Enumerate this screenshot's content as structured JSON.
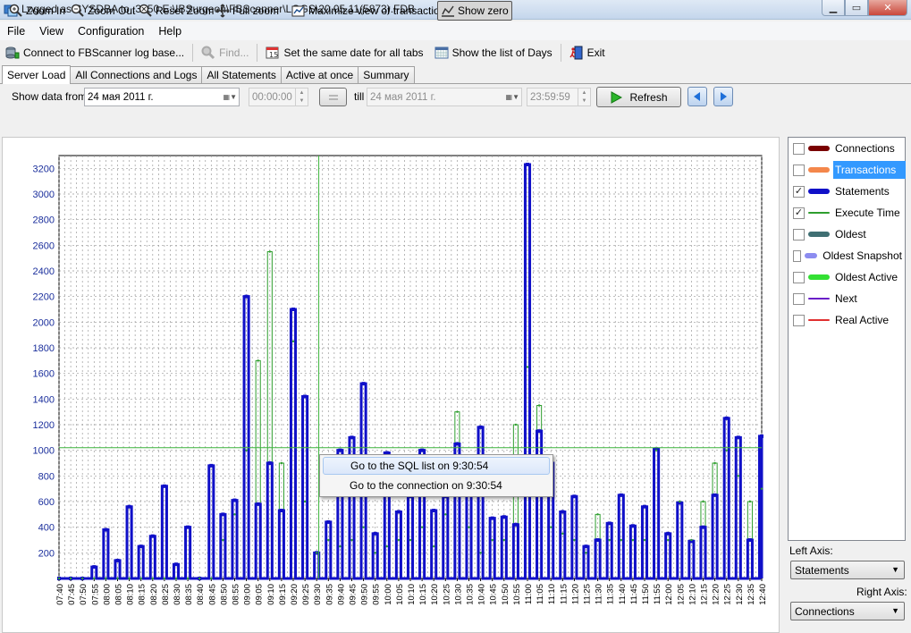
{
  "window": {
    "title": "Logged as SYSDBA to :3050 E:\\IBSurgeon\\FBScanner\\LOGS\\20.05.11(5873).FDB"
  },
  "menu": [
    "File",
    "View",
    "Configuration",
    "Help"
  ],
  "toolbar": {
    "connect": "Connect to FBScanner log base...",
    "find": "Find...",
    "same_date": "Set the same date for all tabs",
    "list_days": "Show the list of Days",
    "exit": "Exit"
  },
  "tabs": [
    "Server Load",
    "All Connections and Logs",
    "All Statements",
    "Active at once",
    "Summary"
  ],
  "daterow": {
    "show_from_label": "Show data from",
    "from_date": "24    мая    2011 г.",
    "from_time": "00:00:00",
    "till_label": "till",
    "till_date": "24    мая    2011 г.",
    "till_time": "23:59:59",
    "refresh": "Refresh"
  },
  "zoom": {
    "zoom_in": "Zoom In",
    "zoom_out": "Zoom Out",
    "reset": "Reset Zoom",
    "full": "Full zoom",
    "maximize": "Maximize view of transaction",
    "show_zero": "Show zero"
  },
  "legend": [
    {
      "label": "Connections",
      "checked": false,
      "color": "#7a0000",
      "thick": true
    },
    {
      "label": "Transactions",
      "checked": false,
      "color": "#f4874b",
      "thick": true,
      "selected": true
    },
    {
      "label": "Statements",
      "checked": true,
      "color": "#1010c8",
      "thick": true
    },
    {
      "label": "Execute Time",
      "checked": true,
      "color": "#2e9e2e",
      "thick": false
    },
    {
      "label": "Oldest",
      "checked": false,
      "color": "#3f6f73",
      "thick": true
    },
    {
      "label": "Oldest Snapshot",
      "checked": false,
      "color": "#8c8cf0",
      "thick": true
    },
    {
      "label": "Oldest Active",
      "checked": false,
      "color": "#33e033",
      "thick": true
    },
    {
      "label": "Next",
      "checked": false,
      "color": "#6a1ec8",
      "thick": false
    },
    {
      "label": "Real Active",
      "checked": false,
      "color": "#e03030",
      "thick": false
    }
  ],
  "axes_select": {
    "left_label": "Left Axis:",
    "left_value": "Statements",
    "right_label": "Right Axis:",
    "right_value": "Connections"
  },
  "context_menu": {
    "item1": "Go to the SQL list on 9:30:54",
    "item2": "Go to the connection on 9:30:54"
  },
  "chart_data": {
    "type": "line",
    "ylim": [
      0,
      3300
    ],
    "yticks": [
      200,
      400,
      600,
      800,
      1000,
      1200,
      1400,
      1600,
      1800,
      2000,
      2200,
      2400,
      2600,
      2800,
      3000,
      3200
    ],
    "x": [
      "07:40",
      "07:45",
      "07:50",
      "07:55",
      "08:00",
      "08:05",
      "08:10",
      "08:15",
      "08:20",
      "08:25",
      "08:30",
      "08:35",
      "08:40",
      "08:45",
      "08:50",
      "08:55",
      "09:00",
      "09:05",
      "09:10",
      "09:15",
      "09:20",
      "09:25",
      "09:30",
      "09:35",
      "09:40",
      "09:45",
      "09:50",
      "09:55",
      "10:00",
      "10:05",
      "10:10",
      "10:15",
      "10:20",
      "10:25",
      "10:30",
      "10:35",
      "10:40",
      "10:45",
      "10:50",
      "10:55",
      "11:00",
      "11:05",
      "11:10",
      "11:15",
      "11:20",
      "11:25",
      "11:30",
      "11:35",
      "11:40",
      "11:45",
      "11:50",
      "11:55",
      "12:00",
      "12:05",
      "12:10",
      "12:15",
      "12:20",
      "12:25",
      "12:30",
      "12:35",
      "12:40"
    ],
    "series": [
      {
        "name": "Statements",
        "color": "#1010c8",
        "values": [
          0,
          0,
          0,
          90,
          380,
          140,
          560,
          250,
          330,
          720,
          110,
          400,
          0,
          880,
          500,
          610,
          2200,
          580,
          900,
          530,
          2100,
          1420,
          200,
          440,
          1000,
          1100,
          1520,
          350,
          980,
          520,
          640,
          1000,
          530,
          640,
          1050,
          700,
          1180,
          470,
          480,
          420,
          3230,
          1150,
          900,
          520,
          640,
          250,
          300,
          430,
          650,
          410,
          560,
          1010,
          350,
          590,
          290,
          400,
          650,
          1250,
          1100,
          300,
          1110
        ]
      },
      {
        "name": "Execute Time",
        "color": "#2e9e2e",
        "values": [
          0,
          0,
          0,
          0,
          0,
          0,
          0,
          0,
          0,
          0,
          0,
          0,
          0,
          0,
          300,
          500,
          1000,
          1700,
          2550,
          900,
          1850,
          600,
          200,
          300,
          250,
          300,
          400,
          200,
          250,
          300,
          300,
          400,
          250,
          500,
          1300,
          400,
          200,
          300,
          300,
          1200,
          1650,
          1350,
          400,
          350,
          300,
          200,
          500,
          300,
          300,
          300,
          300,
          1000,
          300,
          600,
          300,
          600,
          900,
          1000,
          800,
          600,
          700
        ]
      }
    ],
    "crosshair": {
      "x": "09:30:54",
      "y": 1020
    }
  }
}
